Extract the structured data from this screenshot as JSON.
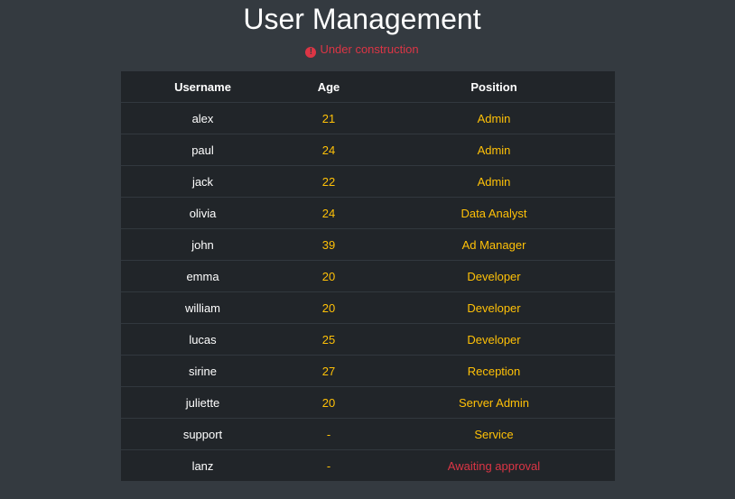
{
  "header": {
    "title": "User Management",
    "notice": "Under construction",
    "notice_icon": "exclamation-circle-icon",
    "notice_color": "#dc3545"
  },
  "colors": {
    "background": "#343a40",
    "table_background": "#212529",
    "accent": "#ffc107",
    "danger": "#dc3545"
  },
  "table": {
    "columns": [
      "Username",
      "Age",
      "Position"
    ],
    "rows": [
      {
        "username": "alex",
        "age": "21",
        "position": "Admin",
        "status": "normal"
      },
      {
        "username": "paul",
        "age": "24",
        "position": "Admin",
        "status": "normal"
      },
      {
        "username": "jack",
        "age": "22",
        "position": "Admin",
        "status": "normal"
      },
      {
        "username": "olivia",
        "age": "24",
        "position": "Data Analyst",
        "status": "normal"
      },
      {
        "username": "john",
        "age": "39",
        "position": "Ad Manager",
        "status": "normal"
      },
      {
        "username": "emma",
        "age": "20",
        "position": "Developer",
        "status": "normal"
      },
      {
        "username": "william",
        "age": "20",
        "position": "Developer",
        "status": "normal"
      },
      {
        "username": "lucas",
        "age": "25",
        "position": "Developer",
        "status": "normal"
      },
      {
        "username": "sirine",
        "age": "27",
        "position": "Reception",
        "status": "normal"
      },
      {
        "username": "juliette",
        "age": "20",
        "position": "Server Admin",
        "status": "normal"
      },
      {
        "username": "support",
        "age": "-",
        "position": "Service",
        "status": "normal"
      },
      {
        "username": "lanz",
        "age": "-",
        "position": "Awaiting approval",
        "status": "pending"
      }
    ]
  }
}
